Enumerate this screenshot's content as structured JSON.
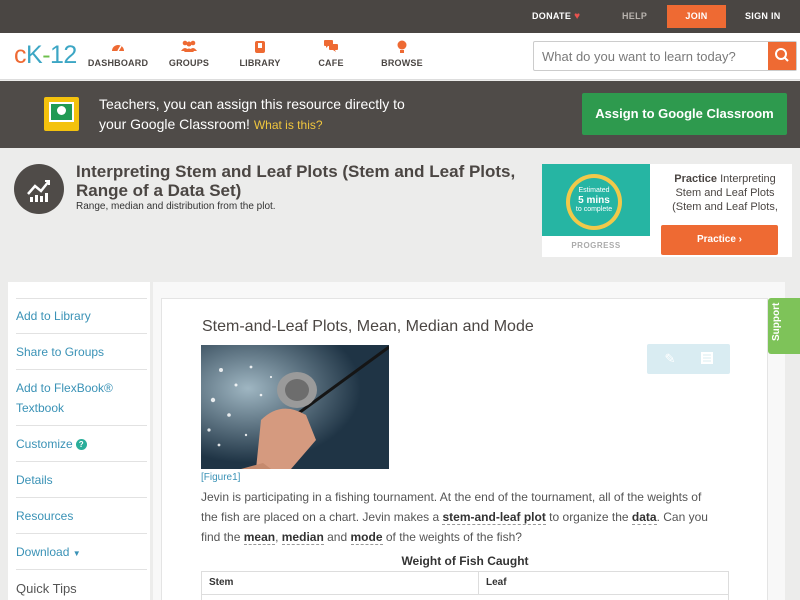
{
  "topbar": {
    "donate": "DONATE",
    "help": "HELP",
    "join": "JOIN",
    "signin": "SIGN IN"
  },
  "nav": {
    "logo": {
      "c": "c",
      "k": "K",
      "dash": "-",
      "n": "12"
    },
    "items": [
      {
        "label": "DASHBOARD",
        "icon": "dashboard-icon"
      },
      {
        "label": "GROUPS",
        "icon": "groups-icon"
      },
      {
        "label": "LIBRARY",
        "icon": "library-icon"
      },
      {
        "label": "CAFE",
        "icon": "cafe-icon"
      },
      {
        "label": "BROWSE",
        "icon": "browse-icon"
      }
    ],
    "search_placeholder": "What do you want to learn today?"
  },
  "banner": {
    "line1": "Teachers, you can assign this resource directly to",
    "line2": "your Google Classroom!",
    "what": "What is this?",
    "assign": "Assign to Google Classroom"
  },
  "resource": {
    "title": "Interpreting Stem and Leaf Plots (Stem and Leaf Plots, Range of a Data Set)",
    "subtitle": "Range, median and distribution from the plot."
  },
  "practice": {
    "badge_top": "Estimated",
    "badge_mid": "5 mins",
    "badge_bot": "to complete",
    "progress": "PROGRESS",
    "bold": "Practice",
    "text1": "Interpreting",
    "text2": "Stem and Leaf Plots",
    "text3": "(Stem and Leaf Plots,",
    "button": "Practice"
  },
  "sidebar": {
    "items": [
      "Add to Library",
      "Share to Groups",
      "Add to FlexBook®",
      "Textbook",
      "Customize",
      "Details",
      "Resources",
      "Download"
    ],
    "quick_tips": "Quick Tips"
  },
  "article": {
    "title": "Stem-and-Leaf Plots, Mean, Median and Mode",
    "figure": "[Figure1]",
    "p1": "Jevin is participating in a fishing tournament. At the end of the tournament, all of the weights of the fish are placed on a chart. Jevin makes a",
    "t1": "stem-and-leaf plot",
    "p2": "to organize the",
    "t2": "data",
    "p3": ". Can you find the",
    "t3": "mean",
    "p4": ",",
    "t4": "median",
    "p5": "and",
    "t5": "mode",
    "p6": "of the weights of the fish?",
    "table_title": "Weight of Fish Caught",
    "col_stem": "Stem",
    "col_leaf": "Leaf"
  },
  "support": "Support",
  "colors": {
    "accent": "#ee6a33",
    "link": "#3a92b6",
    "assign_green": "#2e9a4e",
    "dark_bar": "#4a4643"
  }
}
